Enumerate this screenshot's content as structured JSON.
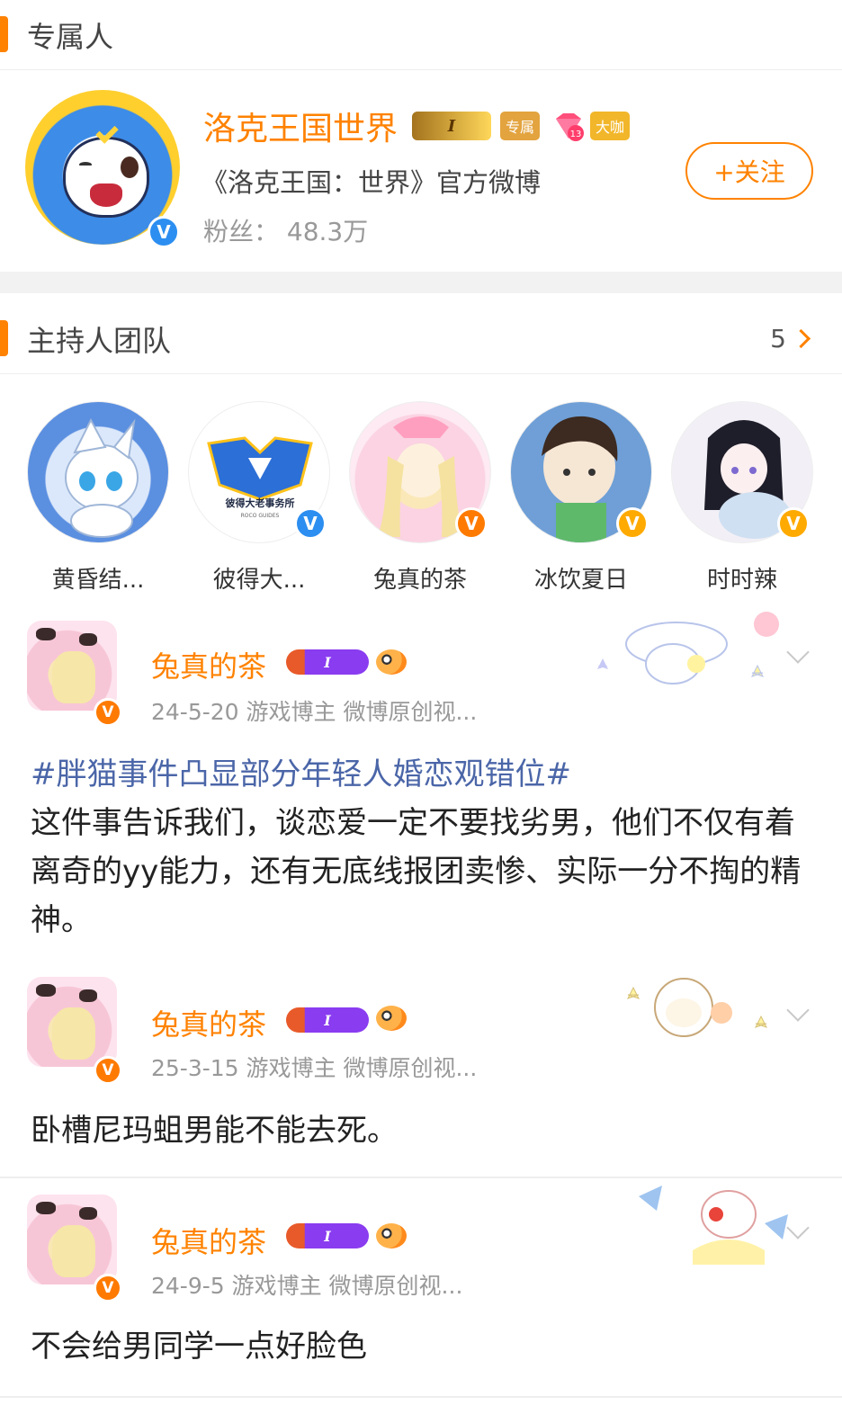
{
  "exclusive": {
    "section_title": "专属人",
    "account": {
      "name": "洛克王国世界",
      "crown_level": "I",
      "tag_exclusive": "专属",
      "gem_level": "13",
      "tag_bigname": "大咖",
      "description": "《洛克王国：世界》官方微博",
      "fans": "粉丝：  48.3万",
      "follow_label": "+关注",
      "verified_mark": "V"
    }
  },
  "hosts": {
    "section_title": "主持人团队",
    "count": "5",
    "items": [
      {
        "name": "黄昏结...",
        "verified": ""
      },
      {
        "name": "彼得大...",
        "verified": "V",
        "logo_text": "彼得大老事务所",
        "logo_sub": "ROCO GUIDES"
      },
      {
        "name": "兔真的茶",
        "verified": "V"
      },
      {
        "name": "冰饮夏日",
        "verified": "V"
      },
      {
        "name": "时时辣",
        "verified": "V"
      }
    ]
  },
  "posts": [
    {
      "author": "兔真的茶",
      "rank": "I",
      "verified": "V",
      "meta": "24-5-20  游戏博主 微博原创视...",
      "hashtag": "#胖猫事件凸显部分年轻人婚恋观错位#",
      "text": "这件事告诉我们，谈恋爱一定不要找劣男，他们不仅有着离奇的yy能力，还有无底线报团卖惨、实际一分不掏的精神。"
    },
    {
      "author": "兔真的茶",
      "rank": "I",
      "verified": "V",
      "meta": "25-3-15  游戏博主 微博原创视...",
      "hashtag": "",
      "text": "卧槽尼玛蛆男能不能去死。"
    },
    {
      "author": "兔真的茶",
      "rank": "I",
      "verified": "V",
      "meta": "24-9-5  游戏博主 微博原创视...",
      "hashtag": "",
      "text": "不会给男同学一点好脸色"
    }
  ],
  "colors": {
    "accent": "#ff8200",
    "hashtag": "#4b66a8",
    "verified_blue": "#2c8ef0",
    "verified_orange": "#ff7a00",
    "verified_yellow": "#ffaa00"
  },
  "icons": [
    "crown-badge-icon",
    "gem-level-icon",
    "verified-icon",
    "chevron-right-icon",
    "chevron-down-icon",
    "rank-badge-icon",
    "fish-badge-icon"
  ]
}
